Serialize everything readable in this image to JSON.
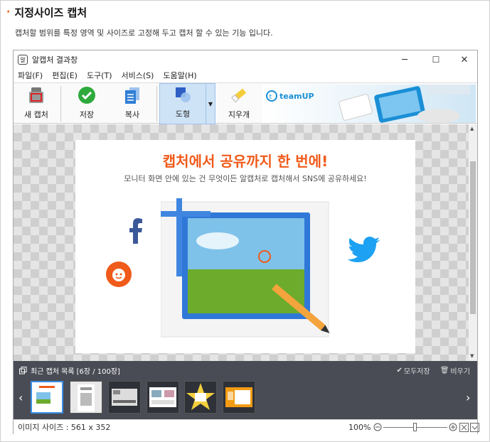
{
  "section": {
    "title": "지정사이즈 캡처",
    "description": "캡처할 범위를 특정 영역 및 사이즈로 고정해 두고 캡처 할 수 있는 기능 입니다."
  },
  "window": {
    "title": "알캡처 결과창",
    "controls": {
      "minimize": "─",
      "maximize": "☐",
      "close": "✕"
    }
  },
  "menu": [
    "파일(F)",
    "편집(E)",
    "도구(T)",
    "서비스(S)",
    "도움말(H)"
  ],
  "toolbar": {
    "new_capture": "새 캡처",
    "save": "저장",
    "copy": "복사",
    "shape": "도형",
    "eraser": "지우개"
  },
  "banner": {
    "logo": "teamUP"
  },
  "content": {
    "headline": "캡처에서 공유까지 한 번에!",
    "subline": "모니터 화면 안에 있는 건 무엇이든 알캡처로 캡처해서 SNS에 공유하세요!"
  },
  "recent": {
    "label": "최근 캡처 목록",
    "count": "[6장 / 100장]",
    "save_all": "모두저장",
    "clear": "비우기"
  },
  "status": {
    "image_size": "이미지 사이즈 : 561 x 352",
    "zoom": "100%"
  },
  "colors": {
    "accent": "#f05a1a",
    "panel": "#4a4c55",
    "selected": "#3a8ee6"
  }
}
